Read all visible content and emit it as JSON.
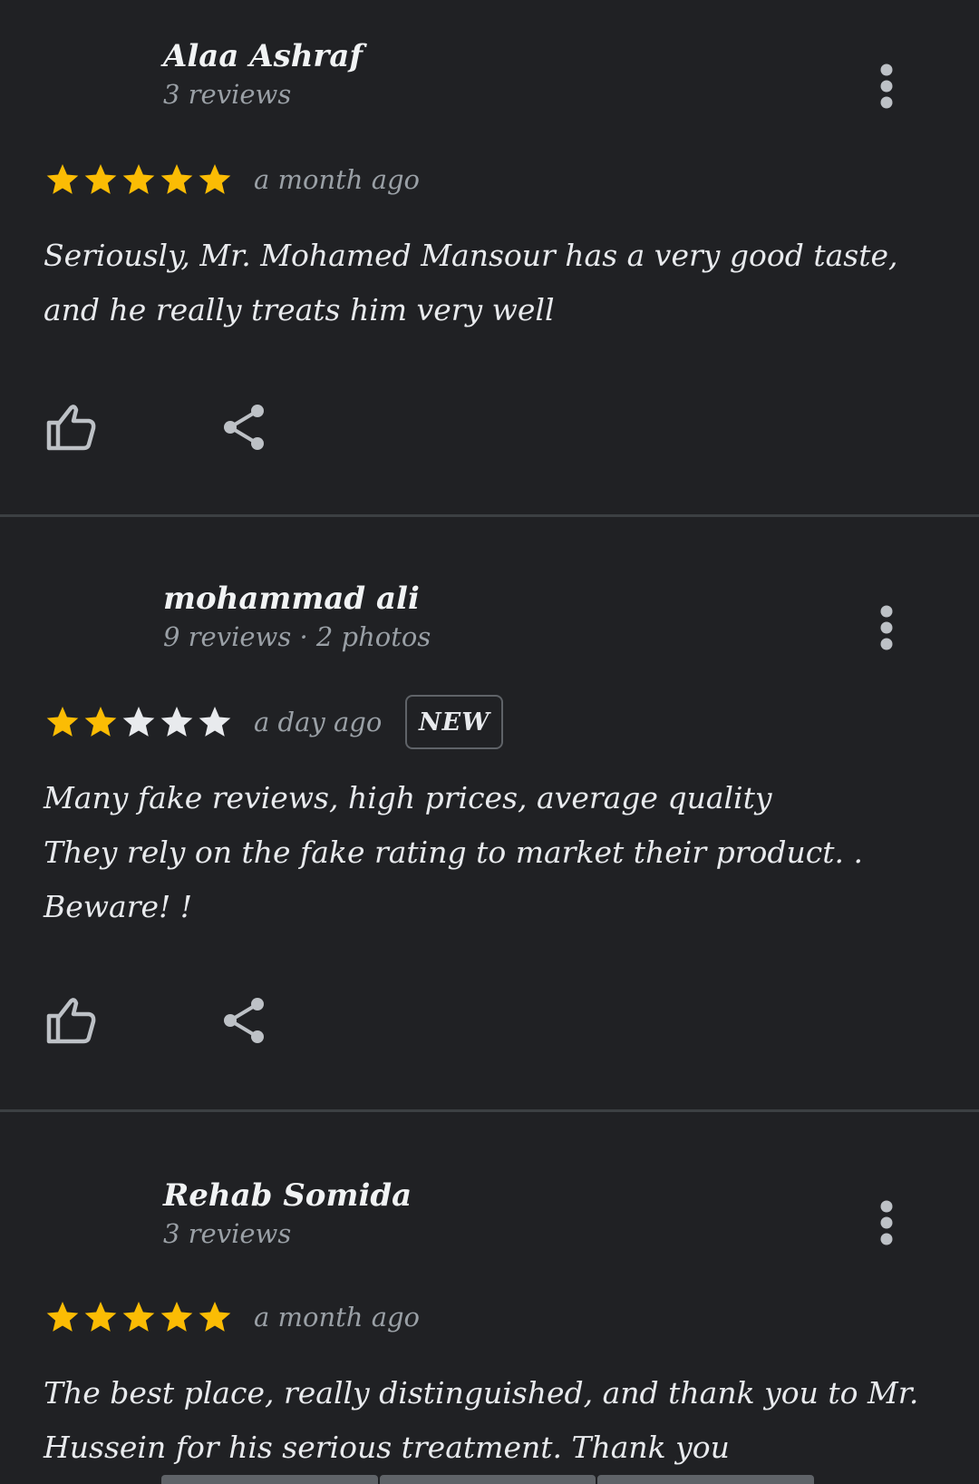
{
  "reviews": [
    {
      "name": "Alaa Ashraf",
      "meta": "3 reviews",
      "rating": 5,
      "time": "a month ago",
      "badge": "",
      "text": "Seriously,  Mr.  Mohamed Mansour has a very good taste,  and he really treats him very well"
    },
    {
      "name": "mohammad ali",
      "meta": "9 reviews · 2 photos",
      "rating": 2,
      "time": "a day ago",
      "badge": "NEW",
      "text": "Many fake reviews,  high prices,  average quality\nThey rely on the fake rating to market their product. .\nBeware! !"
    },
    {
      "name": "Rehab Somida",
      "meta": "3 reviews",
      "rating": 5,
      "time": "a month ago",
      "badge": "",
      "text": "The best place,  really distinguished,  and thank you to Mr. Hussein for his serious treatment.  Thank you"
    }
  ],
  "icons": {
    "like": "thumbs-up-icon",
    "share": "share-icon",
    "more": "more-vert-icon",
    "star": "star-icon"
  },
  "colors": {
    "background": "#202124",
    "star_filled": "#fbbc04",
    "star_empty": "#e8eaed",
    "meta_text": "#9aa0a6",
    "divider": "#3c4043"
  }
}
